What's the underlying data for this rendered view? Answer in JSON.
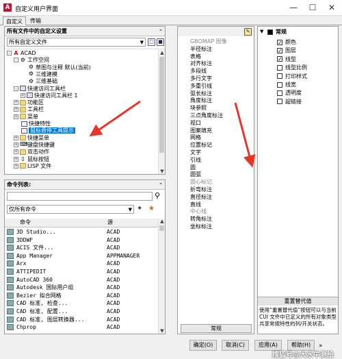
{
  "window": {
    "title": "自定义用户界面",
    "app_icon": "A"
  },
  "tabs": [
    {
      "label": "自定义"
    },
    {
      "label": "传输"
    }
  ],
  "customizations": {
    "header": "所有文件中的自定义设置",
    "dropdown": "所有自定义文件",
    "tree": [
      {
        "label": "ACAD",
        "level": 0,
        "expander": "-",
        "icon": "acad-icon"
      },
      {
        "label": "工作空间",
        "level": 1,
        "expander": "-",
        "icon": "gear-icon"
      },
      {
        "label": "草图与注释 默认(当前)",
        "level": 2,
        "expander": "",
        "icon": "gear-icon"
      },
      {
        "label": "三维建模",
        "level": 2,
        "expander": "",
        "icon": "gear-icon"
      },
      {
        "label": "三维基础",
        "level": 2,
        "expander": "",
        "icon": "gear-icon"
      },
      {
        "label": "快速访问工具栏",
        "level": 1,
        "expander": "-",
        "icon": "toolbar-icon"
      },
      {
        "label": "快速访问工具栏 1",
        "level": 2,
        "expander": "+",
        "icon": "toolbar-icon"
      },
      {
        "label": "功能区",
        "level": 1,
        "expander": "+",
        "icon": "folder-icon"
      },
      {
        "label": "工具栏",
        "level": 1,
        "expander": "+",
        "icon": "folder-icon"
      },
      {
        "label": "菜单",
        "level": 1,
        "expander": "+",
        "icon": "folder-icon"
      },
      {
        "label": "快捷特性",
        "level": 1,
        "expander": "",
        "icon": "properties-icon"
      },
      {
        "label": "鼠标悬停工具提示",
        "level": 1,
        "expander": "",
        "icon": "tooltip-icon",
        "selected": true
      },
      {
        "label": "快捷菜单",
        "level": 1,
        "expander": "+",
        "icon": "folder-icon"
      },
      {
        "label": "键盘快捷键",
        "level": 1,
        "expander": "+",
        "icon": "keyboard-icon"
      },
      {
        "label": "双击动作",
        "level": 1,
        "expander": "+",
        "icon": "folder-icon"
      },
      {
        "label": "鼠标按钮",
        "level": 1,
        "expander": "+",
        "icon": "mouse-icon"
      },
      {
        "label": "LISP 文件",
        "level": 1,
        "expander": "+",
        "icon": "folder-icon"
      }
    ]
  },
  "commands": {
    "header": "命令列表:",
    "filter": "仅所有命令",
    "columns": [
      "命令",
      "源"
    ],
    "rows": [
      {
        "name": "3D Studio...",
        "source": "ACAD"
      },
      {
        "name": "3DDWF",
        "source": "ACAD"
      },
      {
        "name": "ACIS 文件...",
        "source": "ACAD"
      },
      {
        "name": "App Manager",
        "source": "APPMANAGER"
      },
      {
        "name": "Arx",
        "source": "ACAD"
      },
      {
        "name": "ATTIPEDIT",
        "source": "ACAD"
      },
      {
        "name": "AutoCAD 360",
        "source": "ACAD"
      },
      {
        "name": "Autodesk 国际用户组",
        "source": "ACAD"
      },
      {
        "name": "Bezier 拟合网格",
        "source": "ACAD"
      },
      {
        "name": "CAD 标准, 检查...",
        "source": "ACAD"
      },
      {
        "name": "CAD 标准, 配置...",
        "source": "ACAD"
      },
      {
        "name": "CAD 标准, 图层转换器...",
        "source": "ACAD"
      },
      {
        "name": "Chprop",
        "source": "ACAD"
      }
    ]
  },
  "object_types": {
    "footer": "常规",
    "items": [
      {
        "label": "GBOMAP 图像",
        "gray": true
      },
      {
        "label": "半径标注"
      },
      {
        "label": "表格"
      },
      {
        "label": "对齐标注"
      },
      {
        "label": "多段线"
      },
      {
        "label": "多行文字"
      },
      {
        "label": "多重引线"
      },
      {
        "label": "弧长标注"
      },
      {
        "label": "角度标注"
      },
      {
        "label": "块参照"
      },
      {
        "label": "三点角度标注"
      },
      {
        "label": "视口"
      },
      {
        "label": "图案填充"
      },
      {
        "label": "网格"
      },
      {
        "label": "位置标记"
      },
      {
        "label": "文字"
      },
      {
        "label": "引线"
      },
      {
        "label": "圆"
      },
      {
        "label": "圆弧"
      },
      {
        "label": "圆心标记",
        "gray": true
      },
      {
        "label": "折弯标注"
      },
      {
        "label": "直径标注"
      },
      {
        "label": "直线"
      },
      {
        "label": "中心线",
        "gray": true
      },
      {
        "label": "转角标注"
      },
      {
        "label": "坐标标注"
      }
    ]
  },
  "properties": {
    "category": "常规",
    "items": [
      {
        "label": "颜色",
        "checked": true
      },
      {
        "label": "图层",
        "checked": true
      },
      {
        "label": "线型",
        "checked": true
      },
      {
        "label": "线型比例",
        "checked": false
      },
      {
        "label": "打印样式",
        "checked": false
      },
      {
        "label": "线宽",
        "checked": false
      },
      {
        "label": "透明度",
        "checked": false
      },
      {
        "label": "超链接",
        "checked": false
      }
    ],
    "override_button": "重置替代值",
    "description": "使用“重置替代值”按钮可以与当前 CUI 文件中已定义的所有对象类型共享常规特性的列/开关状态。"
  },
  "buttons": {
    "ok": "确定(O)",
    "cancel": "取消(C)",
    "apply": "应用(A)",
    "help": "帮助(H)"
  },
  "watermark": "搜狐号@大水牛测绘",
  "colors": {
    "accent": "#0078d7",
    "arrow": "#e8352a",
    "app": "#c8102e"
  }
}
